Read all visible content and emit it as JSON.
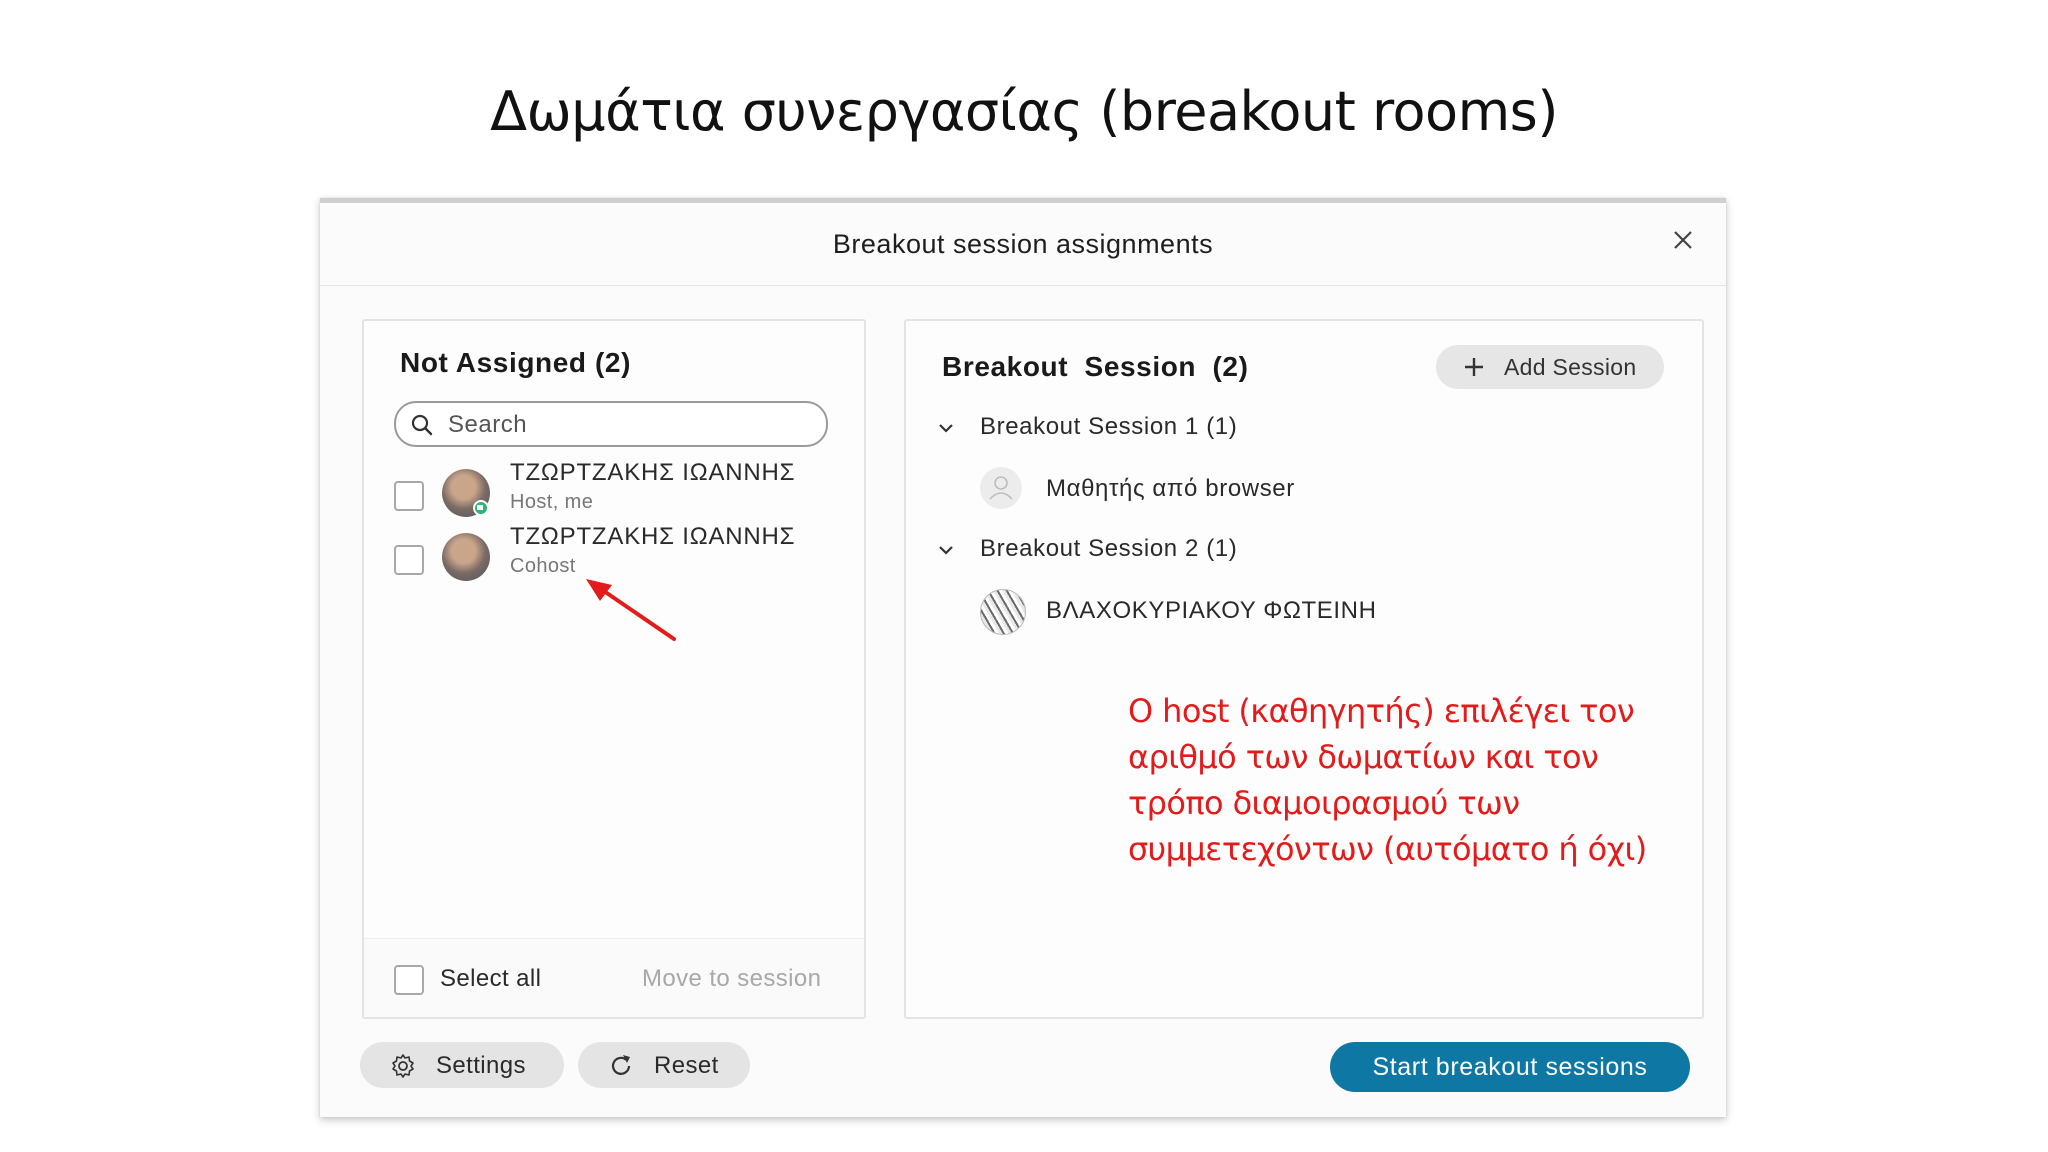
{
  "slide": {
    "title": "Δωμάτια συνεργασίας (breakout rooms)"
  },
  "dialog": {
    "title": "Breakout session assignments"
  },
  "not_assigned": {
    "heading": "Not Assigned (2)",
    "search_placeholder": "Search",
    "members": [
      {
        "name": "ΤΖΩΡΤΖΑΚΗΣ ΙΩΑΝΝΗΣ",
        "role": "Host, me"
      },
      {
        "name": "ΤΖΩΡΤΖΑΚΗΣ ΙΩΑΝΝΗΣ",
        "role": "Cohost"
      }
    ],
    "select_all_label": "Select all",
    "move_to_session_label": "Move to session"
  },
  "breakout": {
    "heading": "Breakout Session (2)",
    "add_session_label": "Add Session",
    "sessions": [
      {
        "label": "Breakout Session 1 (1)",
        "members": [
          "Μαθητής από browser"
        ]
      },
      {
        "label": "Breakout Session 2 (1)",
        "members": [
          "ΒΛΑΧΟΚΥΡΙΑΚΟΥ ΦΩΤΕΙΝΗ"
        ]
      }
    ]
  },
  "annotation": {
    "lines": [
      "Ο host (καθηγητής) επιλέγει τον",
      "αριθμό των δωματίων και τον",
      "τρόπο διαμοιρασμού των",
      "συμμετεχόντων (αυτόματο ή όχι)"
    ],
    "color": "#e31b1b"
  },
  "footer": {
    "settings_label": "Settings",
    "reset_label": "Reset",
    "start_label": "Start breakout sessions"
  },
  "colors": {
    "primary": "#0e77a3",
    "annotation": "#e31b1b"
  },
  "icons": [
    "close-icon",
    "search-icon",
    "plus-icon",
    "chevron-down-icon",
    "gear-icon",
    "refresh-icon",
    "user-placeholder-icon",
    "arrow-annotation"
  ]
}
